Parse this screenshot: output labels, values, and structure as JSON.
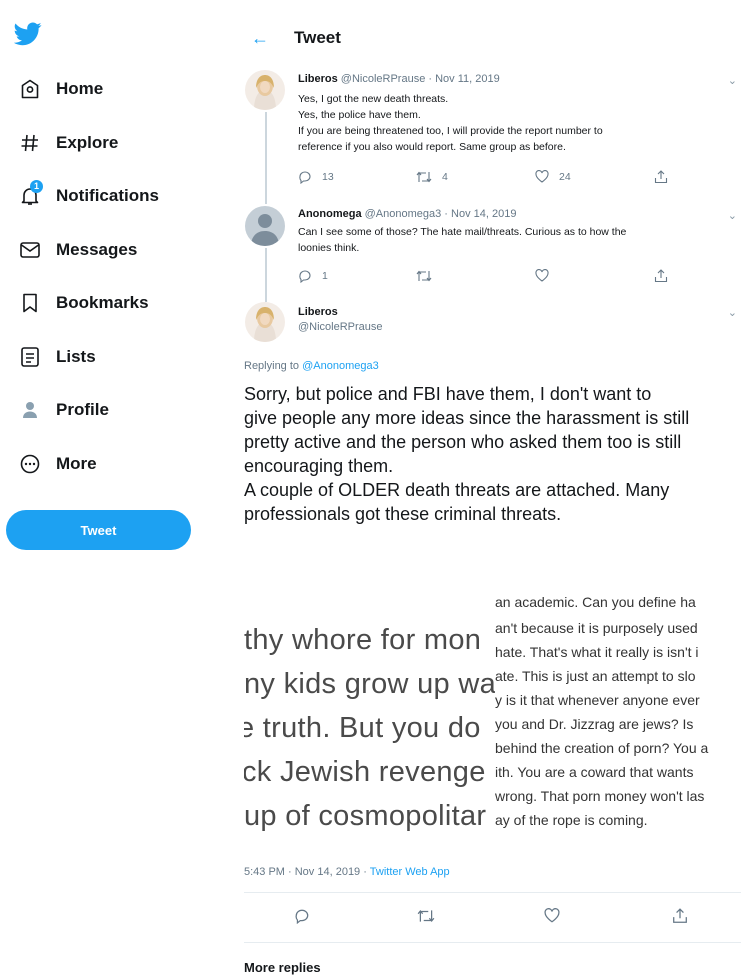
{
  "sidebar": {
    "logo_icon": "twitter-bird-icon",
    "items": [
      {
        "label": "Home",
        "icon": "home-icon"
      },
      {
        "label": "Explore",
        "icon": "hashtag-icon"
      },
      {
        "label": "Notifications",
        "icon": "bell-icon",
        "badge": "1"
      },
      {
        "label": "Messages",
        "icon": "envelope-icon"
      },
      {
        "label": "Bookmarks",
        "icon": "bookmark-icon"
      },
      {
        "label": "Lists",
        "icon": "list-icon"
      },
      {
        "label": "Profile",
        "icon": "person-icon"
      },
      {
        "label": "More",
        "icon": "more-circle-icon"
      }
    ],
    "tweet_button": "Tweet"
  },
  "header": {
    "back_icon": "←",
    "title": "Tweet"
  },
  "thread": [
    {
      "name": "Liberos",
      "meta": "@NicoleRPrause · Nov 11, 2019",
      "lines": [
        "Yes, I got the new death threats.",
        "Yes, the police have them.",
        "If you are being threatened too, I will provide the report number to",
        "reference if you also would report. Same group as before."
      ],
      "replies": "13",
      "retweets": "4",
      "likes": "24"
    },
    {
      "name": "Anonomega",
      "meta": "@Anonomega3 · Nov 14, 2019",
      "lines": [
        "Can I see some of those? The hate mail/threats. Curious as to how the",
        "loonies think."
      ],
      "replies": "1",
      "retweets": "",
      "likes": ""
    }
  ],
  "main_tweet": {
    "name": "Liberos",
    "handle": "@NicoleRPrause",
    "replying_label": "Replying to ",
    "replying_handle": "@Anonomega3",
    "lines": [
      "Sorry, but police and FBI have them, I don't want to",
      "give people any more ideas since the harassment is still",
      "pretty active and the person who asked them too is still",
      "encouraging them.",
      "A couple of OLDER death threats are attached. Many",
      "professionals got these criminal threats."
    ],
    "image_left_lines": [
      "thy whore for mon",
      "ny kids grow up wa",
      "e truth. But you do",
      "ck Jewish revenge",
      "up of cosmopolitar"
    ],
    "image_right_lines": [
      "an academic. Can you define ha",
      "an't because it is purposely used",
      "hate. That's what it really is isn't i",
      "ate. This is just an attempt to slo",
      "y is it that whenever anyone ever",
      "you and Dr. Jizzrag are jews? Is",
      "behind the creation of porn? You a",
      "ith. You are a coward that wants",
      "wrong. That porn money won't las",
      "ay of the rope is coming."
    ],
    "timestamp": "5:43 PM · Nov 14, 2019 · ",
    "app": "Twitter Web App"
  },
  "more_replies": "More replies",
  "colors": {
    "accent": "#1da1f2",
    "text": "#14171a",
    "muted": "#657786"
  }
}
